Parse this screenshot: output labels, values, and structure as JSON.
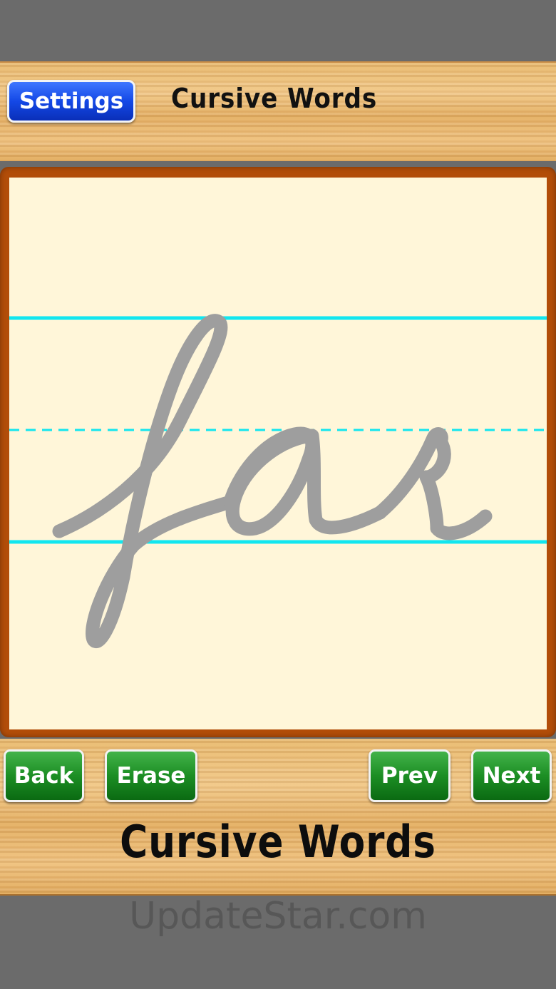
{
  "header": {
    "settings_label": "Settings",
    "title": "Cursive Words"
  },
  "board": {
    "word": "far",
    "guide_line_color": "#12e6ef",
    "trace_color": "#9e9e9e",
    "paper_color": "#fff6d9",
    "frame_color": "#b24d09"
  },
  "toolbar": {
    "back_label": "Back",
    "erase_label": "Erase",
    "prev_label": "Prev",
    "next_label": "Next"
  },
  "footer": {
    "title": "Cursive Words"
  },
  "watermark": {
    "text": "UpdateStar.com"
  }
}
